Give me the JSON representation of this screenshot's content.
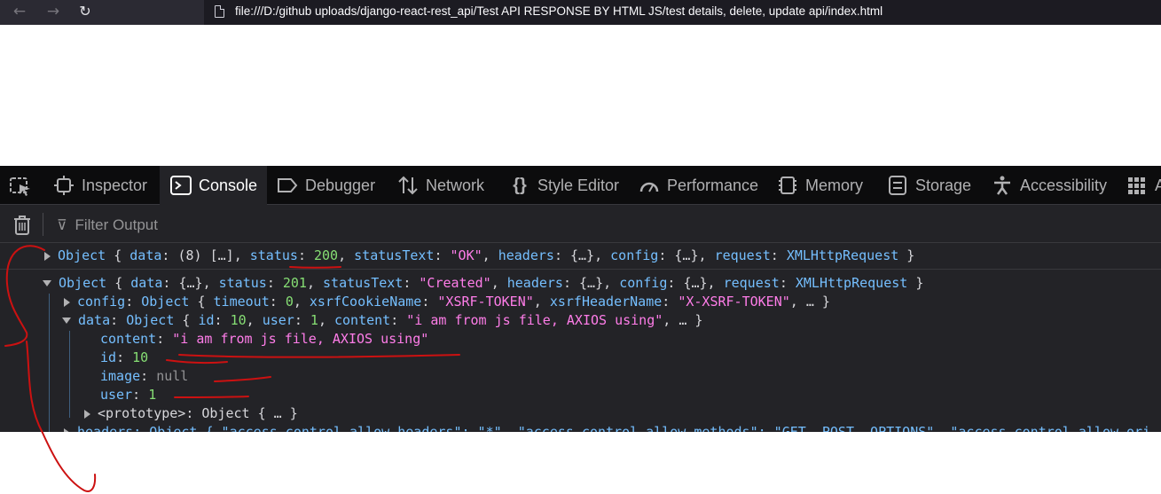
{
  "browser": {
    "back_icon": "←",
    "forward_icon": "→",
    "reload_icon": "↻",
    "url": "file:///D:/github uploads/django-react-rest_api/Test API RESPONSE BY HTML JS/test details, delete, update api/index.html"
  },
  "devtools": {
    "tabs": [
      {
        "label": "Inspector",
        "icon": "inspector-icon"
      },
      {
        "label": "Console",
        "icon": "console-icon",
        "active": true
      },
      {
        "label": "Debugger",
        "icon": "debugger-icon"
      },
      {
        "label": "Network",
        "icon": "network-icon"
      },
      {
        "label": "Style Editor",
        "icon": "style-editor-icon"
      },
      {
        "label": "Performance",
        "icon": "performance-icon"
      },
      {
        "label": "Memory",
        "icon": "memory-icon"
      },
      {
        "label": "Storage",
        "icon": "storage-icon"
      },
      {
        "label": "Accessibility",
        "icon": "accessibility-icon"
      },
      {
        "label": "A",
        "icon": "more-tools-icon"
      }
    ],
    "filter_placeholder": "Filter Output",
    "accent_color": "#0a84ff"
  },
  "console": {
    "line1": {
      "object": "Object",
      "data_key": "data",
      "data_val": "(8) […]",
      "status_key": "status",
      "status_val": "200",
      "statusText_key": "statusText",
      "statusText_val": "\"OK\"",
      "headers_key": "headers",
      "headers_val": "{…}",
      "config_key": "config",
      "config_val": "{…}",
      "request_key": "request",
      "request_val": "XMLHttpRequest"
    },
    "line2": {
      "object": "Object",
      "data_key": "data",
      "data_val": "{…}",
      "status_key": "status",
      "status_val": "201",
      "statusText_key": "statusText",
      "statusText_val": "\"Created\"",
      "headers_key": "headers",
      "headers_val": "{…}",
      "config_key": "config",
      "config_val": "{…}",
      "request_key": "request",
      "request_val": "XMLHttpRequest"
    },
    "config_line": {
      "key": "config",
      "object": "Object",
      "timeout_key": "timeout",
      "timeout_val": "0",
      "xsrfCookieName_key": "xsrfCookieName",
      "xsrfCookieName_val": "\"XSRF-TOKEN\"",
      "xsrfHeaderName_key": "xsrfHeaderName",
      "xsrfHeaderName_val": "\"X-XSRF-TOKEN\"",
      "more": "…"
    },
    "data_line": {
      "key": "data",
      "object": "Object",
      "id_key": "id",
      "id_val": "10",
      "user_key": "user",
      "user_val": "1",
      "content_key": "content",
      "content_val": "\"i am from js file, AXIOS using\"",
      "more": "…"
    },
    "props": {
      "content_key": "content",
      "content_val": "\"i am from js file, AXIOS using\"",
      "id_key": "id",
      "id_val": "10",
      "image_key": "image",
      "image_val": "null",
      "user_key": "user",
      "user_val": "1"
    },
    "prototype_line": {
      "key": "<prototype>",
      "object": "Object",
      "val": "{ … }"
    },
    "headers_line": "headers: Object { \"access-control-allow-headers\": \"*\", \"access-control-allow-methods\": \"GET, POST, OPTIONS\", \"access-control-allow-ori"
  },
  "annotation_color": "#cc1111"
}
